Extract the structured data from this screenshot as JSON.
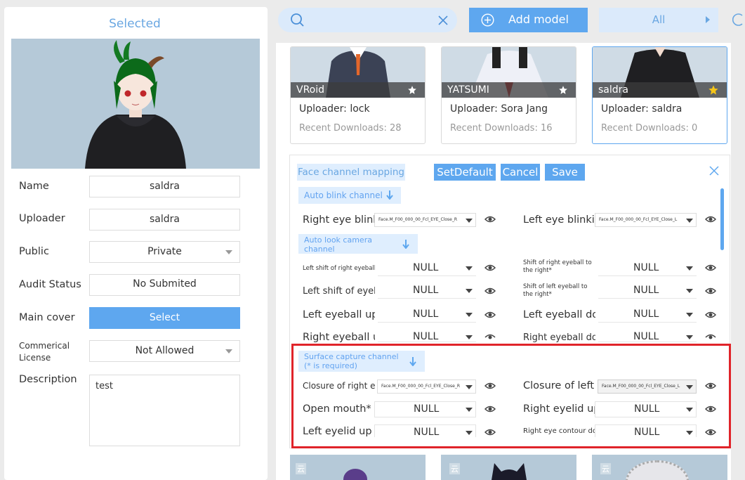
{
  "left_panel": {
    "header": "Selected",
    "name_label": "Name",
    "name_value": "saldra",
    "uploader_label": "Uploader",
    "uploader_value": "saldra",
    "public_label": "Public",
    "public_value": "Private",
    "audit_label": "Audit Status",
    "audit_value": "No Submited",
    "cover_label": "Main cover",
    "cover_button": "Select",
    "license_label": "Commerical License",
    "license_value": "Not Allowed",
    "description_label": "Description",
    "description_value": "test"
  },
  "top_bar": {
    "search_value": "",
    "add_model_label": "Add model",
    "filter_value": "All"
  },
  "model_cards": [
    {
      "name": "VRoid",
      "uploader": "Uploader: lock",
      "downloads": "Recent Downloads: 28",
      "starred": false
    },
    {
      "name": "YATSUMI",
      "uploader": "Uploader: Sora Jang",
      "downloads": "Recent Downloads: 16",
      "starred": false
    },
    {
      "name": "saldra",
      "uploader": "Uploader: saldra",
      "downloads": "Recent Downloads: 0",
      "starred": true
    }
  ],
  "bottom_cards": [
    {
      "badge": "云"
    },
    {
      "badge": "云"
    },
    {
      "badge": "云"
    }
  ],
  "mapping_dialog": {
    "title": "Face channel mapping",
    "set_default": "SetDefault",
    "cancel": "Cancel",
    "save": "Save",
    "auto_blink": "Auto blink channel",
    "auto_look": "Auto look camera channel",
    "surface_capture": "Surface capture channel (* is required)",
    "rows": {
      "right_eye_blink_label": "Right eye blinking",
      "right_eye_blink_value": "Face.M_F00_000_00_Fcl_EYE_Close_R",
      "left_eye_blink_label": "Left eye blinking",
      "left_eye_blink_value": "Face.M_F00_000_00_Fcl_EYE_Close_L",
      "left_shift_right_eyeball_label": "Left shift of right eyeball*",
      "left_shift_right_eyeball_value": "NULL",
      "shift_right_eyeball_right_label": "Shift of right eyeball to the right*",
      "shift_right_eyeball_right_value": "NULL",
      "left_shift_eyeball_label": "Left shift of eyeball",
      "left_shift_eyeball_value": "NULL",
      "shift_left_eyeball_right_label": "Shift of left eyeball to the right*",
      "shift_left_eyeball_right_value": "NULL",
      "left_eyeball_up_label": "Left eyeball up*",
      "left_eyeball_up_value": "NULL",
      "left_eyeball_down_label": "Left eyeball down",
      "left_eyeball_down_value": "NULL",
      "right_eyeball_up_label": "Right eyeball up",
      "right_eyeball_up_value": "NULL",
      "right_eyeball_down_label": "Right eyeball down",
      "right_eyeball_down_value": "NULL",
      "closure_right_eye_label": "Closure of right eye*",
      "closure_right_eye_value": "Face.M_F00_000_00_Fcl_EYE_Close_R",
      "closure_left_eye_label": "Closure of left eye",
      "closure_left_eye_value": "Face.M_F00_000_00_Fcl_EYE_Close_L",
      "open_mouth_label": "Open mouth*",
      "open_mouth_value": "NULL",
      "right_eyelid_up_label": "Right eyelid up",
      "right_eyelid_up_value": "NULL",
      "left_eyelid_up_label": "Left eyelid up",
      "left_eyelid_up_value": "NULL",
      "right_eye_contour_down_label": "Right eye contour down",
      "right_eye_contour_down_value": "NULL"
    }
  },
  "colors": {
    "accent": "#5ea7ef",
    "highlight": "#e0242a",
    "star_active": "#f5c518"
  }
}
